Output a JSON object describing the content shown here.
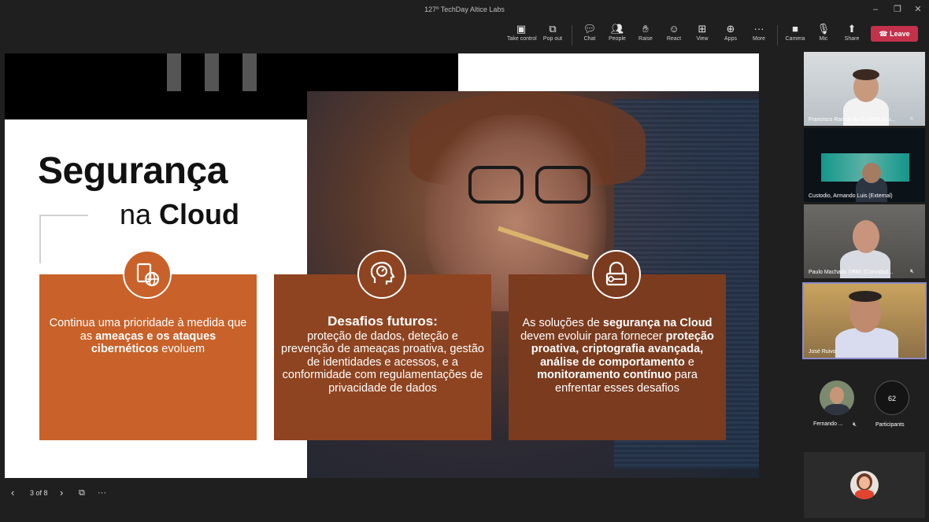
{
  "window": {
    "title": "127º TechDay Altice Labs",
    "controls": [
      "–",
      "❐",
      "✕"
    ]
  },
  "toolbar": {
    "buttons": [
      {
        "label": "Take control",
        "icon": "take-control-icon"
      },
      {
        "label": "Pop out",
        "icon": "pop-out-icon"
      },
      {
        "label": "Chat",
        "icon": "chat-icon"
      },
      {
        "label": "People",
        "icon": "people-icon"
      },
      {
        "label": "Raise",
        "icon": "raise-hand-icon"
      },
      {
        "label": "React",
        "icon": "react-icon"
      },
      {
        "label": "View",
        "icon": "view-icon"
      },
      {
        "label": "Apps",
        "icon": "apps-icon"
      },
      {
        "label": "More",
        "icon": "more-icon"
      },
      {
        "label": "Camera",
        "icon": "camera-off-icon"
      },
      {
        "label": "Mic",
        "icon": "mic-off-icon"
      },
      {
        "label": "Share",
        "icon": "share-icon"
      }
    ],
    "leave_label": "Leave"
  },
  "slide": {
    "title_line1": "Segurança",
    "title_line2_prefix": "na ",
    "title_line2_bold": "Cloud",
    "cards": [
      {
        "color": "#c8622a",
        "parts": [
          {
            "t": "Continua uma prioridade à medida que as ",
            "b": false
          },
          {
            "t": "ameaças e os ataques cibernéticos",
            "b": true
          },
          {
            "t": " evoluem",
            "b": false
          }
        ]
      },
      {
        "color": "#8e4420",
        "parts": [
          {
            "t": "Desafios futuros:",
            "b": true,
            "big": true
          },
          {
            "t": " proteção de dados, deteção e prevenção de ameaças proativa, gestão de identidades e acessos, e a conformidade com regulamentações de privacidade de dados",
            "b": false
          }
        ]
      },
      {
        "color": "#7b3b1e",
        "parts": [
          {
            "t": "As soluções de ",
            "b": false
          },
          {
            "t": "segurança na Cloud",
            "b": true
          },
          {
            "t": " devem evoluir para fornecer ",
            "b": false
          },
          {
            "t": "proteção proativa, criptografia avançada, análise de comportamento",
            "b": true
          },
          {
            "t": " e ",
            "b": false
          },
          {
            "t": "monitoramento contínuo",
            "b": true
          },
          {
            "t": " para enfrentar esses desafios",
            "b": false
          }
        ]
      }
    ]
  },
  "gallery": {
    "tiles": [
      {
        "name": "Francisco Ramos do Ó (IBM) (Gu...",
        "muted": true
      },
      {
        "name": "Custodio, Armando Luis (External)",
        "muted": false
      },
      {
        "name": "Paulo Machado (IBM) (Convidad...",
        "muted": true
      },
      {
        "name": "José Ruivo",
        "muted": false,
        "active": true
      }
    ],
    "small_participant": "Fernando ...",
    "participants_count": "62",
    "participants_label": "Participants"
  },
  "presenter_controls": {
    "page_indicator": "3 of 8"
  },
  "colors": {
    "leave": "#c4314b",
    "accent": "#8b8cc7"
  }
}
